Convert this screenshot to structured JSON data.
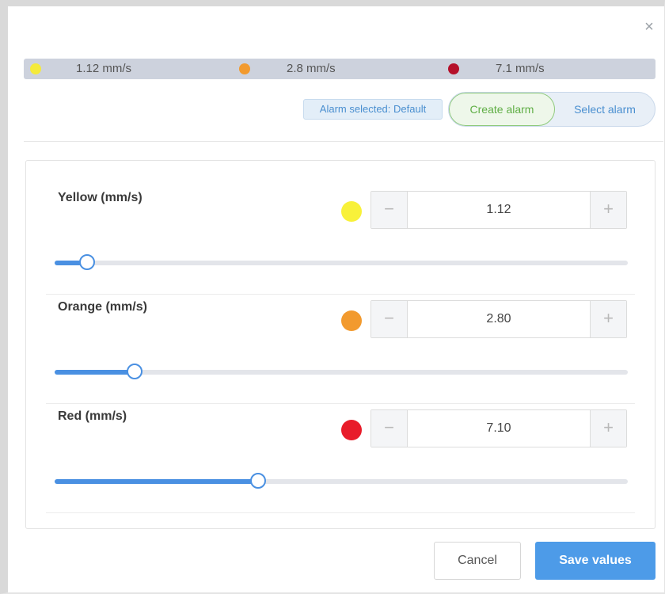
{
  "dialog": {
    "close_label": "×"
  },
  "summary": {
    "items": [
      {
        "value": "1.12 mm/s",
        "color": "#f4ea3c"
      },
      {
        "value": "2.8 mm/s",
        "color": "#f29a2e"
      },
      {
        "value": "7.1 mm/s",
        "color": "#b5102a"
      }
    ]
  },
  "alarm": {
    "selected_badge": "Alarm selected: Default",
    "create_label": "Create alarm",
    "select_label": "Select alarm"
  },
  "thresholds": [
    {
      "label": "Yellow (mm/s)",
      "value": "1.12",
      "color": "#f8f13a",
      "level": 0.056
    },
    {
      "label": "Orange (mm/s)",
      "value": "2.80",
      "color": "#f29a2e",
      "level": 0.14
    },
    {
      "label": "Red (mm/s)",
      "value": "7.10",
      "color": "#e81c2a",
      "level": 0.355
    }
  ],
  "stepper": {
    "minus": "−",
    "plus": "+"
  },
  "footer": {
    "cancel_label": "Cancel",
    "save_label": "Save values"
  }
}
